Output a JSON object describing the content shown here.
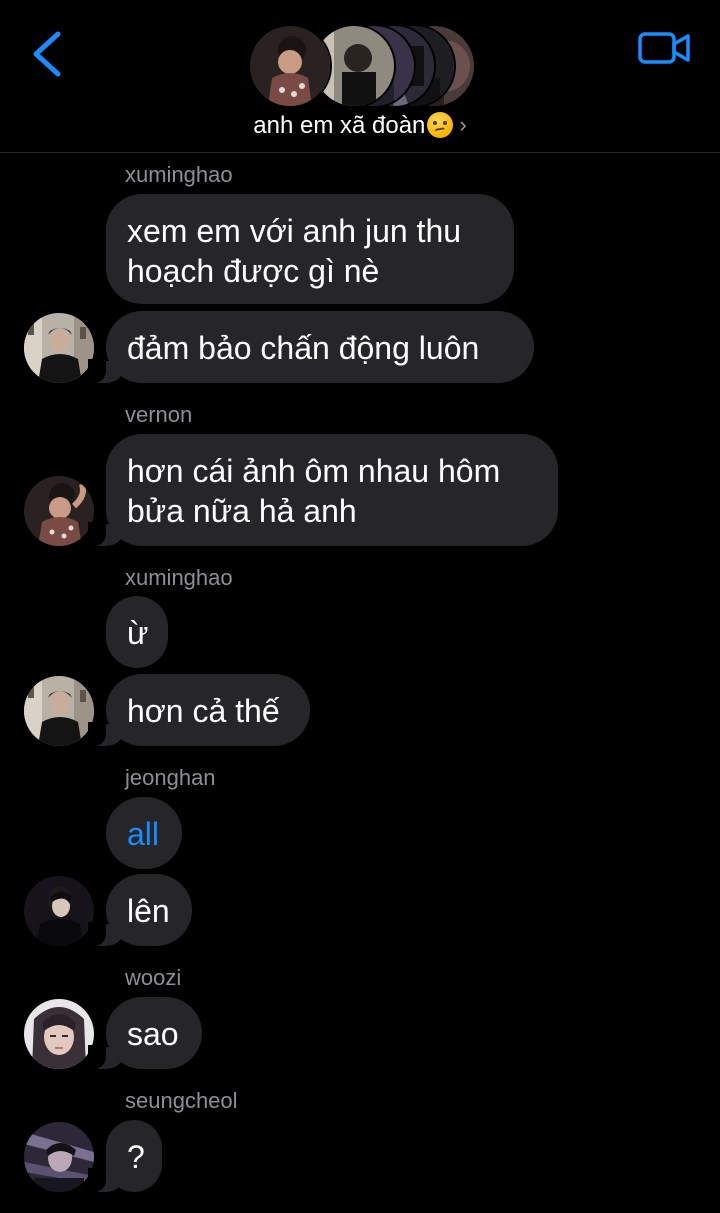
{
  "header": {
    "back_icon": "chevron-left-icon",
    "video_icon": "video-camera-icon",
    "group_name": "anh em xã đoàn",
    "emoji_icon": "woozy-face-emoji",
    "chevron_label": "›",
    "accent_color": "#1a8cff"
  },
  "messages": [
    {
      "sender": "xuminghao",
      "bubbles": [
        "xem em với anh jun thu hoạch được gì nè",
        "đảm bảo chấn động luôn"
      ]
    },
    {
      "sender": "vernon",
      "bubbles": [
        "hơn cái ảnh ôm nhau hôm bửa nữa hả anh"
      ]
    },
    {
      "sender": "xuminghao",
      "bubbles": [
        "ừ",
        "hơn cả thế"
      ]
    },
    {
      "sender": "jeonghan",
      "bubbles": [
        "all",
        "lên"
      ]
    },
    {
      "sender": "woozi",
      "bubbles": [
        "sao"
      ]
    },
    {
      "sender": "seungcheol",
      "bubbles": [
        "?"
      ]
    }
  ],
  "colors": {
    "background": "#000000",
    "bubble": "#262628",
    "sender_label": "#8e8e93",
    "mention": "#1a8cff"
  }
}
